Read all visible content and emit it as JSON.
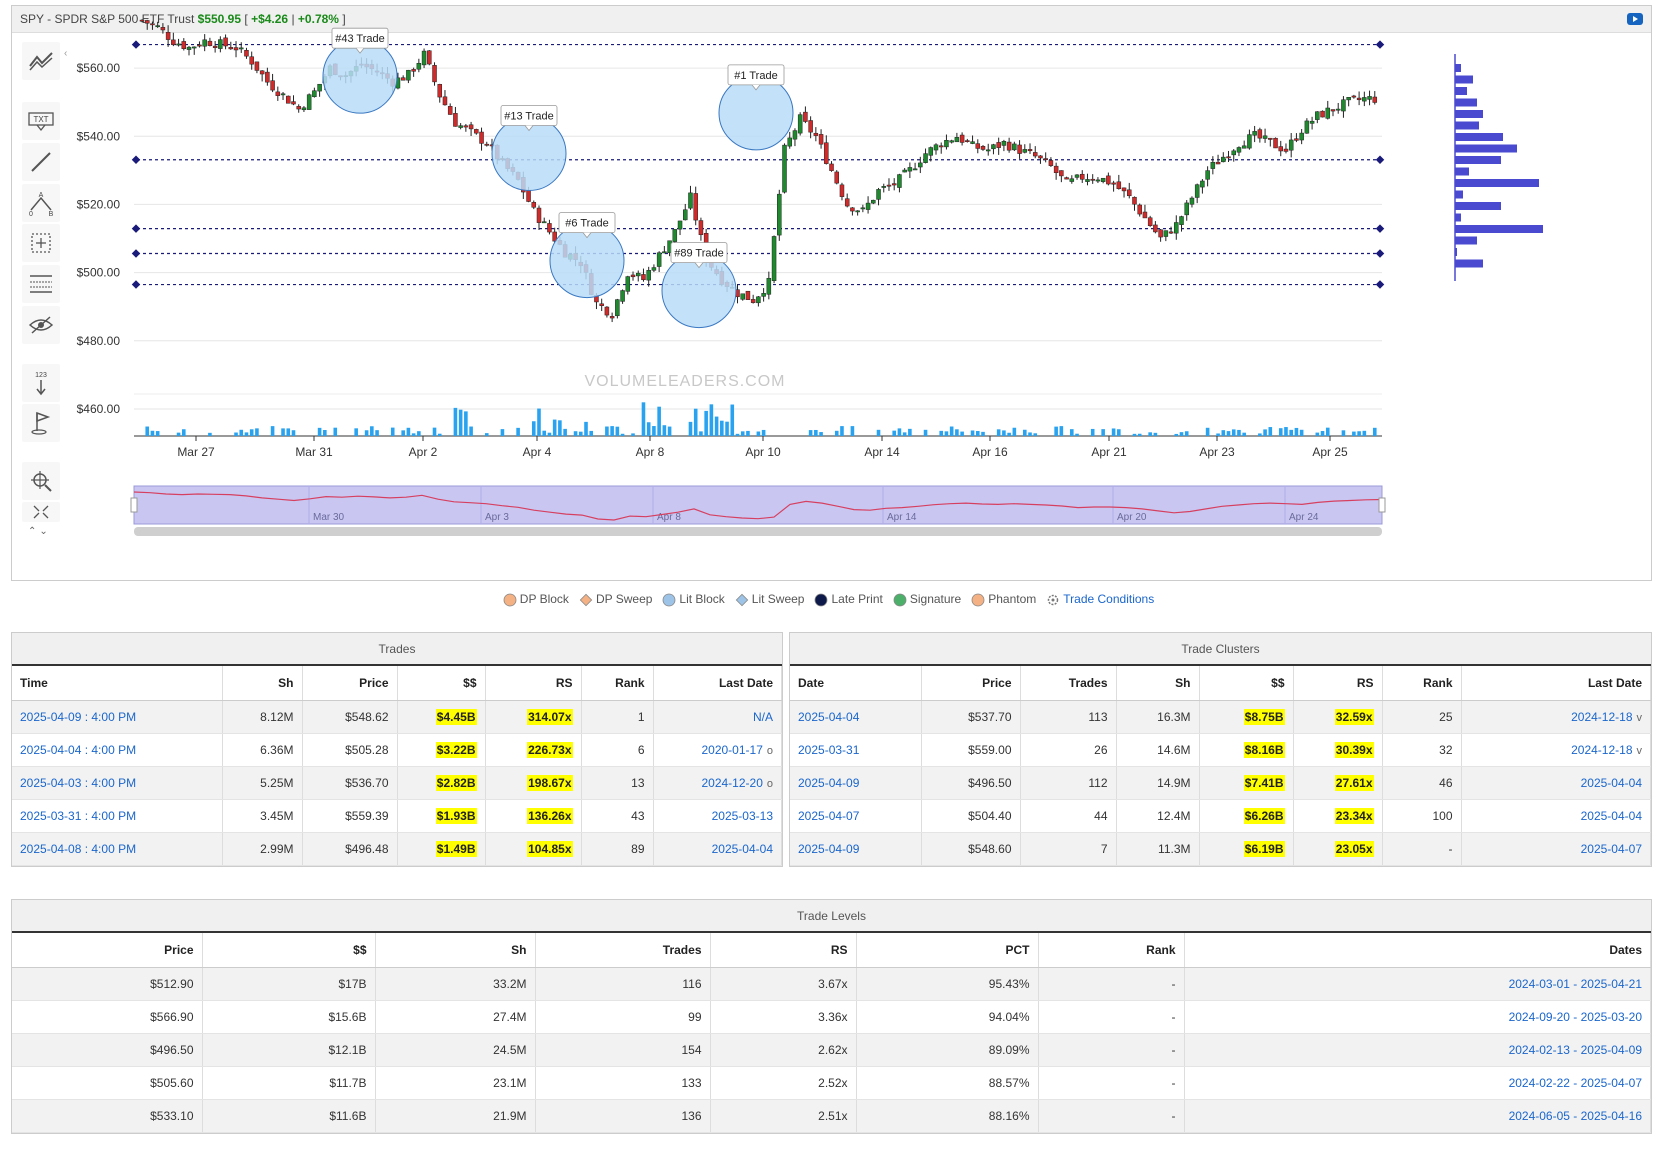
{
  "header": {
    "title": "SPY - SPDR S&P 500 ETF Trust",
    "price": "$550.95",
    "bracket_open": "[",
    "change": "+$4.26",
    "separator": "|",
    "change_pct": "+0.78%",
    "bracket_close": "]"
  },
  "watermark": "VOLUMELEADERS.COM",
  "colors": {
    "up_candle": "#1e8a2e",
    "down_candle": "#d12a2a",
    "volume_bar": "#29a3f0",
    "level_line": "#1a1a7a",
    "bubble_fill": "#b9dcf7",
    "bubble_stroke": "#3a78c2",
    "navigator_fill": "#c9c7f2",
    "navigator_line": "#d64060",
    "profile_bar": "#4a4ad0",
    "link": "#1a66cc",
    "highlight": "#ffff00"
  },
  "toolbar": [
    {
      "name": "indicators-icon"
    },
    {
      "name": "text-annotation-icon",
      "label": "TXT"
    },
    {
      "name": "line-draw-icon"
    },
    {
      "name": "measure-icon",
      "label": "A B"
    },
    {
      "name": "crosshair-select-icon"
    },
    {
      "name": "table-grid-icon"
    },
    {
      "name": "hide-eye-icon"
    },
    {
      "name": "number-sort-icon",
      "label": "123"
    },
    {
      "name": "flag-icon"
    },
    {
      "name": "zoom-target-icon"
    },
    {
      "name": "fullscreen-icon"
    }
  ],
  "chart_data": {
    "type": "candlestick",
    "y_ticks": [
      "$560.00",
      "$540.00",
      "$520.00",
      "$500.00",
      "$480.00",
      "$460.00"
    ],
    "y_tick_values": [
      560,
      540,
      520,
      500,
      480,
      460
    ],
    "ylim": [
      455,
      570
    ],
    "x_ticks": [
      "Mar 27",
      "Mar 31",
      "Apr 2",
      "Apr 4",
      "Apr 8",
      "Apr 10",
      "Apr 14",
      "Apr 16",
      "Apr 21",
      "Apr 23",
      "Apr 25"
    ],
    "navigator_ticks": [
      "Mar 30",
      "Apr 3",
      "Apr 8",
      "Apr 14",
      "Apr 20",
      "Apr 24"
    ],
    "levels": [
      566.9,
      533.1,
      512.9,
      505.6,
      496.5
    ],
    "trade_markers": [
      {
        "label": "#43 Trade",
        "price": 559.39
      },
      {
        "label": "#13 Trade",
        "price": 536.7
      },
      {
        "label": "#6 Trade",
        "price": 505.28
      },
      {
        "label": "#89 Trade",
        "price": 496.48
      },
      {
        "label": "#1 Trade",
        "price": 548.62
      }
    ],
    "close_path": [
      574,
      572,
      568,
      566,
      568,
      567,
      566,
      562,
      556,
      552,
      548,
      553,
      560,
      558,
      561,
      559,
      556,
      558,
      564,
      552,
      544,
      541,
      538,
      532,
      527,
      518,
      512,
      506,
      503,
      491,
      488,
      500,
      498,
      505,
      512,
      522,
      504,
      498,
      494,
      492,
      497,
      536,
      545,
      540,
      530,
      520,
      518,
      524,
      526,
      530,
      535,
      538,
      540,
      537,
      536,
      538,
      536,
      534,
      531,
      526,
      528,
      528,
      526,
      522,
      516,
      510,
      514,
      522,
      530,
      534,
      538,
      540,
      538,
      536,
      542,
      546,
      548,
      550,
      551
    ]
  },
  "legend": [
    {
      "name": "legend-dp-block",
      "label": "DP Block",
      "shape": "circle",
      "color": "#f4b183"
    },
    {
      "name": "legend-dp-sweep",
      "label": "DP Sweep",
      "shape": "diamond",
      "color": "#f4b183"
    },
    {
      "name": "legend-lit-block",
      "label": "Lit Block",
      "shape": "circle",
      "color": "#9dc3e6"
    },
    {
      "name": "legend-lit-sweep",
      "label": "Lit Sweep",
      "shape": "diamond",
      "color": "#9dc3e6"
    },
    {
      "name": "legend-late-print",
      "label": "Late Print",
      "shape": "circle",
      "color": "#0d1a4a"
    },
    {
      "name": "legend-signature",
      "label": "Signature",
      "shape": "circle",
      "color": "#4caf6a"
    },
    {
      "name": "legend-phantom",
      "label": "Phantom",
      "shape": "circle",
      "color": "#f4b183"
    },
    {
      "name": "legend-trade-conditions",
      "label": "Trade Conditions",
      "shape": "gear",
      "color": "#777"
    }
  ],
  "trades": {
    "title": "Trades",
    "headers": [
      "Time",
      "Sh",
      "Price",
      "$$",
      "RS",
      "Rank",
      "Last Date"
    ],
    "rows": [
      {
        "time": "2025-04-09 : 4:00 PM",
        "sh": "8.12M",
        "price": "$548.62",
        "dollars": "$4.45B",
        "rs": "314.07x",
        "rank": "1",
        "last": "N/A",
        "mark": ""
      },
      {
        "time": "2025-04-04 : 4:00 PM",
        "sh": "6.36M",
        "price": "$505.28",
        "dollars": "$3.22B",
        "rs": "226.73x",
        "rank": "6",
        "last": "2020-01-17",
        "mark": "o"
      },
      {
        "time": "2025-04-03 : 4:00 PM",
        "sh": "5.25M",
        "price": "$536.70",
        "dollars": "$2.82B",
        "rs": "198.67x",
        "rank": "13",
        "last": "2024-12-20",
        "mark": "o"
      },
      {
        "time": "2025-03-31 : 4:00 PM",
        "sh": "3.45M",
        "price": "$559.39",
        "dollars": "$1.93B",
        "rs": "136.26x",
        "rank": "43",
        "last": "2025-03-13",
        "mark": ""
      },
      {
        "time": "2025-04-08 : 4:00 PM",
        "sh": "2.99M",
        "price": "$496.48",
        "dollars": "$1.49B",
        "rs": "104.85x",
        "rank": "89",
        "last": "2025-04-04",
        "mark": ""
      }
    ]
  },
  "clusters": {
    "title": "Trade Clusters",
    "headers": [
      "Date",
      "Price",
      "Trades",
      "Sh",
      "$$",
      "RS",
      "Rank",
      "Last Date"
    ],
    "rows": [
      {
        "date": "2025-04-04",
        "price": "$537.70",
        "trades": "113",
        "sh": "16.3M",
        "dollars": "$8.75B",
        "rs": "32.59x",
        "rank": "25",
        "last": "2024-12-18",
        "mark": "v"
      },
      {
        "date": "2025-03-31",
        "price": "$559.00",
        "trades": "26",
        "sh": "14.6M",
        "dollars": "$8.16B",
        "rs": "30.39x",
        "rank": "32",
        "last": "2024-12-18",
        "mark": "v"
      },
      {
        "date": "2025-04-09",
        "price": "$496.50",
        "trades": "112",
        "sh": "14.9M",
        "dollars": "$7.41B",
        "rs": "27.61x",
        "rank": "46",
        "last": "2025-04-04",
        "mark": ""
      },
      {
        "date": "2025-04-07",
        "price": "$504.40",
        "trades": "44",
        "sh": "12.4M",
        "dollars": "$6.26B",
        "rs": "23.34x",
        "rank": "100",
        "last": "2025-04-04",
        "mark": ""
      },
      {
        "date": "2025-04-09",
        "price": "$548.60",
        "trades": "7",
        "sh": "11.3M",
        "dollars": "$6.19B",
        "rs": "23.05x",
        "rank": "-",
        "last": "2025-04-07",
        "mark": ""
      }
    ]
  },
  "levels_table": {
    "title": "Trade Levels",
    "headers": [
      "Price",
      "$$",
      "Sh",
      "Trades",
      "RS",
      "PCT",
      "Rank",
      "Dates"
    ],
    "rows": [
      {
        "price": "$512.90",
        "dollars": "$17B",
        "sh": "33.2M",
        "trades": "116",
        "rs": "3.67x",
        "pct": "95.43%",
        "rank": "-",
        "dates": "2024-03-01 - 2025-04-21"
      },
      {
        "price": "$566.90",
        "dollars": "$15.6B",
        "sh": "27.4M",
        "trades": "99",
        "rs": "3.36x",
        "pct": "94.04%",
        "rank": "-",
        "dates": "2024-09-20 - 2025-03-20"
      },
      {
        "price": "$496.50",
        "dollars": "$12.1B",
        "sh": "24.5M",
        "trades": "154",
        "rs": "2.62x",
        "pct": "89.09%",
        "rank": "-",
        "dates": "2024-02-13 - 2025-04-09"
      },
      {
        "price": "$505.60",
        "dollars": "$11.7B",
        "sh": "23.1M",
        "trades": "133",
        "rs": "2.52x",
        "pct": "88.57%",
        "rank": "-",
        "dates": "2024-02-22 - 2025-04-07"
      },
      {
        "price": "$533.10",
        "dollars": "$11.6B",
        "sh": "21.9M",
        "trades": "136",
        "rs": "2.51x",
        "pct": "88.16%",
        "rank": "-",
        "dates": "2024-06-05 - 2025-04-16"
      }
    ]
  }
}
